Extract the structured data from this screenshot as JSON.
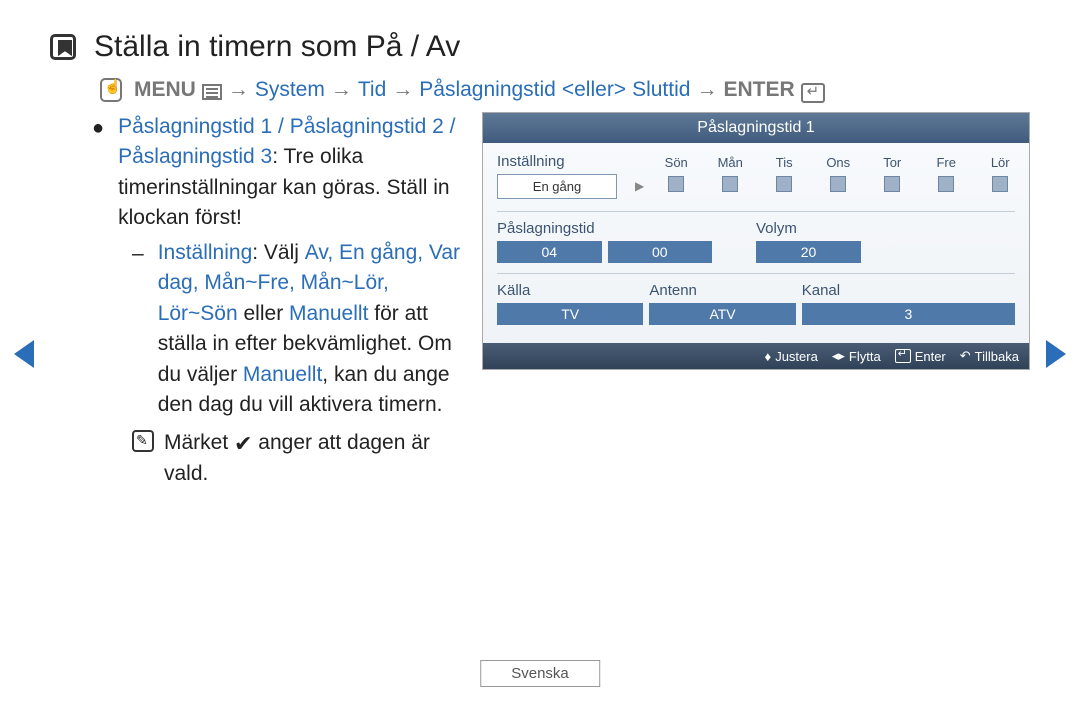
{
  "title": "Ställa in timern som På / Av",
  "breadcrumb": {
    "menu": "MENU",
    "system": "System",
    "tid": "Tid",
    "paslag": "Påslagningstid",
    "eller": "<eller>",
    "sluttid": "Sluttid",
    "enter": "ENTER",
    "arrow": "→"
  },
  "body": {
    "timers_hl": "Påslagningstid 1 / Påslagningstid 2 / Påslagningstid 3",
    "timers_rest": ": Tre olika timerinställningar kan göras. Ställ in klockan först!",
    "inst_hl": "Inställning",
    "inst_mid1": ": Välj ",
    "inst_opts": "Av, En gång, Var dag, Mån~Fre, Mån~Lör, Lör~Sön",
    "inst_mid2": " eller ",
    "inst_man": "Manuellt",
    "inst_rest1": " för att ställa in efter bekvämlighet. Om du väljer ",
    "inst_rest2": ", kan du ange den dag du vill aktivera timern.",
    "note_pre": "Märket ",
    "note_post": " anger att dagen är vald."
  },
  "panel": {
    "header": "Påslagningstid 1",
    "setting_label": "Inställning",
    "setting_value": "En gång",
    "days": [
      "Sön",
      "Mån",
      "Tis",
      "Ons",
      "Tor",
      "Fre",
      "Lör"
    ],
    "time_label": "Påslagningstid",
    "time_h": "04",
    "time_m": "00",
    "vol_label": "Volym",
    "vol_value": "20",
    "src_label": "Källa",
    "src_value": "TV",
    "ant_label": "Antenn",
    "ant_value": "ATV",
    "chan_label": "Kanal",
    "chan_value": "3",
    "foot_adjust": "Justera",
    "foot_move": "Flytta",
    "foot_enter": "Enter",
    "foot_back": "Tillbaka"
  },
  "language": "Svenska"
}
